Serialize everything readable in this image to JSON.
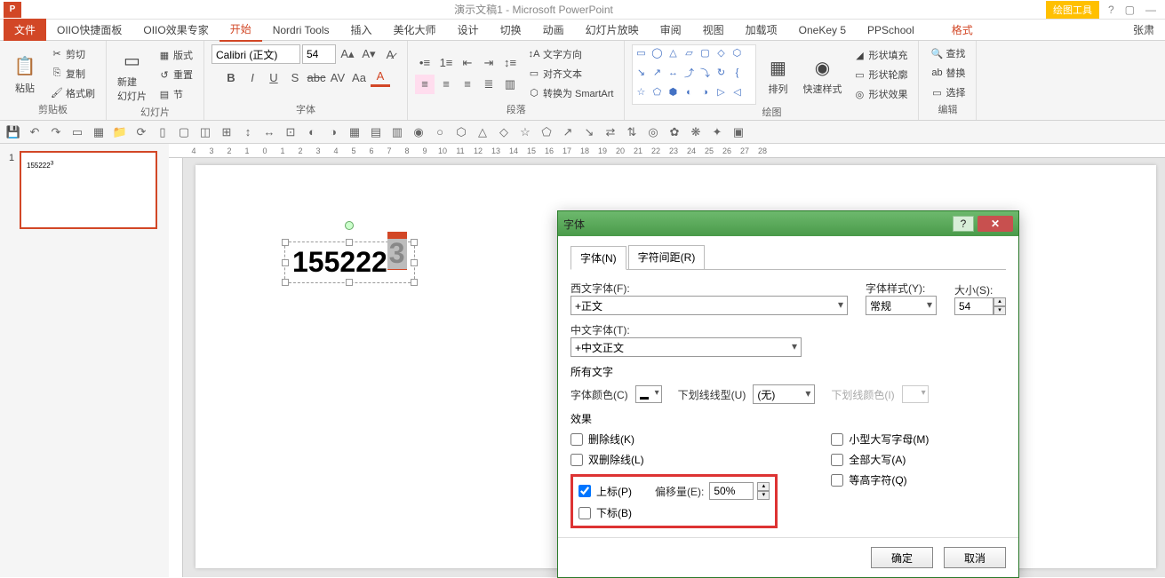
{
  "app": {
    "title": "演示文稿1 - Microsoft PowerPoint",
    "contextual_tool": "绘图工具"
  },
  "tabs": {
    "file": "文件",
    "items": [
      "OIIO快捷面板",
      "OIIO效果专家",
      "开始",
      "Nordri Tools",
      "插入",
      "美化大师",
      "设计",
      "切换",
      "动画",
      "幻灯片放映",
      "审阅",
      "视图",
      "加载项",
      "OneKey 5",
      "PPSchool"
    ],
    "active_index": 2,
    "format": "格式",
    "right": "张肃"
  },
  "ribbon": {
    "clipboard": {
      "label": "剪贴板",
      "paste": "粘贴",
      "cut": "剪切",
      "copy": "复制",
      "painter": "格式刷"
    },
    "slides": {
      "label": "幻灯片",
      "new": "新建\n幻灯片",
      "layout": "版式",
      "reset": "重置",
      "section": "节"
    },
    "font": {
      "label": "字体",
      "family": "Calibri (正文)",
      "size": "54",
      "bold": "B",
      "italic": "I",
      "underline": "U",
      "shadow": "S",
      "strike": "abc",
      "spacing": "AV",
      "case": "Aa",
      "clear": "A",
      "color": "A"
    },
    "paragraph": {
      "label": "段落",
      "text_dir": "文字方向",
      "align": "对齐文本",
      "smartart": "转换为 SmartArt"
    },
    "drawing": {
      "label": "绘图",
      "arrange": "排列",
      "quick": "快速样式",
      "fill": "形状填充",
      "outline": "形状轮廓",
      "effects": "形状效果"
    },
    "editing": {
      "label": "编辑",
      "find": "查找",
      "replace": "替换",
      "select": "选择"
    }
  },
  "slide": {
    "number": "1",
    "text_main": "155222",
    "text_sup": "3"
  },
  "dialog": {
    "title": "字体",
    "tabs": {
      "font": "字体(N)",
      "spacing": "字符间距(R)"
    },
    "west_label": "西文字体(F):",
    "west_value": "+正文",
    "style_label": "字体样式(Y):",
    "style_value": "常规",
    "size_label": "大小(S):",
    "size_value": "54",
    "cn_label": "中文字体(T):",
    "cn_value": "+中文正文",
    "all_text": "所有文字",
    "font_color": "字体颜色(C)",
    "underline_type": "下划线线型(U)",
    "underline_value": "(无)",
    "underline_color": "下划线颜色(I)",
    "effects": "效果",
    "strike": "删除线(K)",
    "dstrike": "双删除线(L)",
    "sup": "上标(P)",
    "offset_label": "偏移量(E):",
    "offset_value": "50%",
    "sub": "下标(B)",
    "smallcaps": "小型大写字母(M)",
    "allcaps": "全部大写(A)",
    "equalh": "等高字符(Q)",
    "ok": "确定",
    "cancel": "取消"
  },
  "ruler": [
    "4",
    "3",
    "2",
    "1",
    "0",
    "1",
    "2",
    "3",
    "4",
    "5",
    "6",
    "7",
    "8",
    "9",
    "10",
    "11",
    "12",
    "13",
    "14",
    "15",
    "16",
    "17",
    "18",
    "19",
    "20",
    "21",
    "22",
    "23",
    "24",
    "25",
    "26",
    "27",
    "28"
  ]
}
